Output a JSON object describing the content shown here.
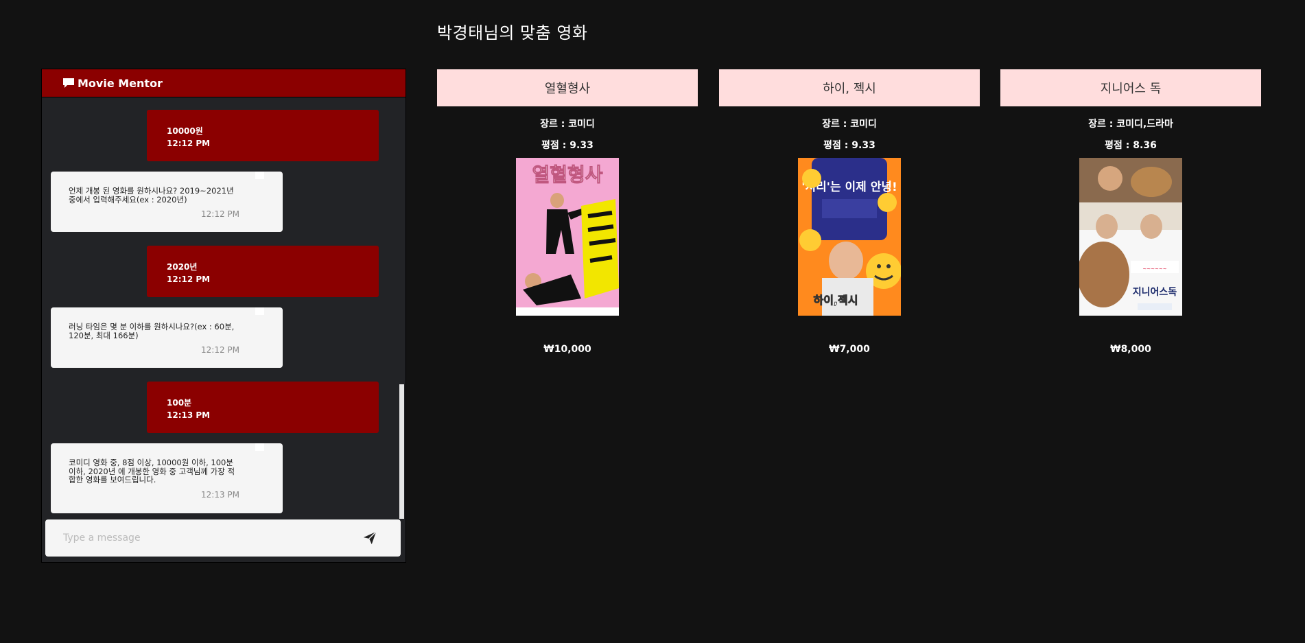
{
  "page_title": "박경태님의 맞춤 영화",
  "chat": {
    "title": "Movie Mentor",
    "messages": [
      {
        "from": "user",
        "text": "10000원",
        "time": "12:12 PM"
      },
      {
        "from": "bot",
        "text": "언제 개봉 된 영화를 원하시나요? 2019~2021년 중에서 입력해주세요(ex : 2020년)",
        "time": "12:12 PM"
      },
      {
        "from": "user",
        "text": "2020년",
        "time": "12:12 PM"
      },
      {
        "from": "bot",
        "text": "러닝 타임은 몇 분 이하를 원하시나요?(ex : 60분, 120분, 최대 166분)",
        "time": "12:12 PM"
      },
      {
        "from": "user",
        "text": "100분",
        "time": "12:13 PM"
      },
      {
        "from": "bot",
        "text": "코미디 영화 중, 8점 이상, 10000원 이하, 100분 이하, 2020년 에 개봉한 영화 중 고객님께 가장 적합한 영화를 보여드립니다.",
        "time": "12:13 PM"
      }
    ],
    "input_placeholder": "Type a message",
    "input_value": ""
  },
  "movies": [
    {
      "title": "열혈형사",
      "genre": "장르 : 코미디",
      "rating": "평점 : 9.33",
      "price": "₩10,000",
      "poster_text": "열혈형사"
    },
    {
      "title": "하이, 젝시",
      "genre": "장르 : 코미디",
      "rating": "평점 : 9.33",
      "price": "₩7,000",
      "poster_text": "하이,젝시",
      "poster_tagline": "'시리'는 이제 안녕!"
    },
    {
      "title": "지니어스 독",
      "genre": "장르 : 코미디,드라마",
      "rating": "평점 : 8.36",
      "price": "₩8,000",
      "poster_text": "지니어스독"
    }
  ],
  "colors": {
    "background": "#121212",
    "accent": "#8b0000",
    "card_header": "#ffdddd",
    "bot_bubble": "#f5f5f5",
    "chat_bg": "#222326"
  },
  "icons": {
    "header": "comment-icon",
    "send": "paper-plane-icon"
  }
}
